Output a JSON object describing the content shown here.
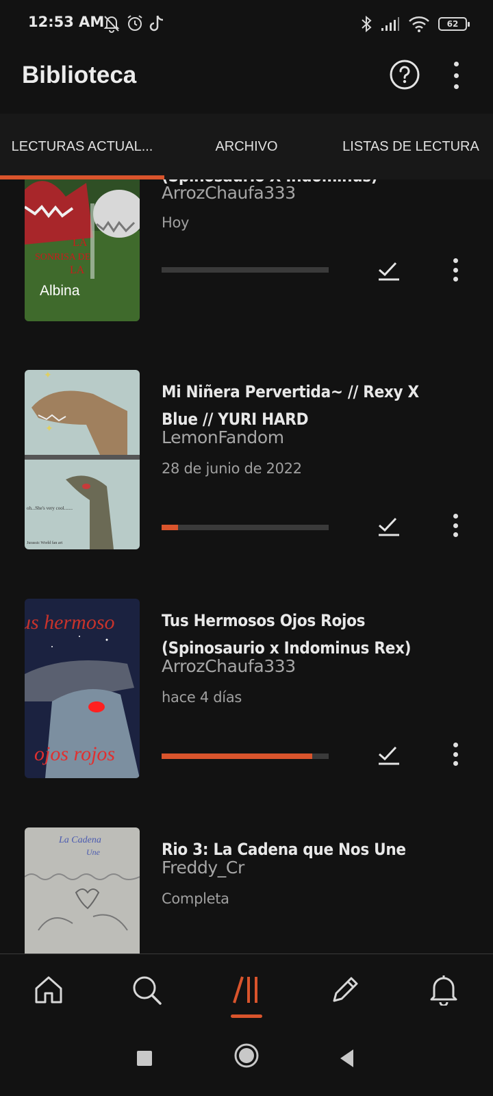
{
  "status_bar": {
    "time": "12:53 AM",
    "battery": "62",
    "left_icons": [
      "bell-off-icon",
      "alarm-icon",
      "tiktok-icon"
    ],
    "right_icons": [
      "bluetooth-icon",
      "signal-icon",
      "wifi-icon",
      "battery-icon"
    ]
  },
  "app_bar": {
    "title": "Biblioteca",
    "actions": [
      "help-icon",
      "more-vert-icon"
    ]
  },
  "tabs": [
    {
      "label": "LECTURAS ACTUAL..."
    },
    {
      "label": "ARCHIVO"
    },
    {
      "label": "LISTAS DE LECTURA"
    }
  ],
  "stories": [
    {
      "title": "(Spinosaurio X Indominus)",
      "author": "ArrozChaufa333",
      "date": "Hoy",
      "progress": 0.0,
      "cover_text": [
        "LA",
        "SONRISA DE",
        "LA",
        "Albina"
      ]
    },
    {
      "title": "Mi Niñera Pervertida~ // Rexy X Blue // YURI HARD",
      "author": "LemonFandom",
      "date": "28 de junio de 2022",
      "progress": 0.1,
      "cover_text": [
        "oh...She's very cool.......",
        "Jurassic World fan art"
      ]
    },
    {
      "title": "Tus Hermosos Ojos Rojos (Spinosaurio x Indominus Rex)",
      "author": "ArrozChaufa333",
      "date": "hace 4 días",
      "progress": 0.9,
      "cover_text": [
        "us hermoso",
        "ojos rojos"
      ]
    },
    {
      "title": "Rio 3: La Cadena que Nos Une",
      "author": "Freddy_Cr",
      "date": "Completa",
      "progress": 0.0,
      "cover_text": [
        "La Cadena",
        "Une"
      ]
    }
  ],
  "colors": {
    "accent": "#d9542c",
    "background": "#121212",
    "tab_bar": "#181818"
  },
  "bottom_nav": [
    "home-icon",
    "search-icon",
    "library-icon",
    "write-icon",
    "notifications-icon"
  ],
  "system_nav": [
    "recents-icon",
    "home-circle-icon",
    "back-icon"
  ]
}
